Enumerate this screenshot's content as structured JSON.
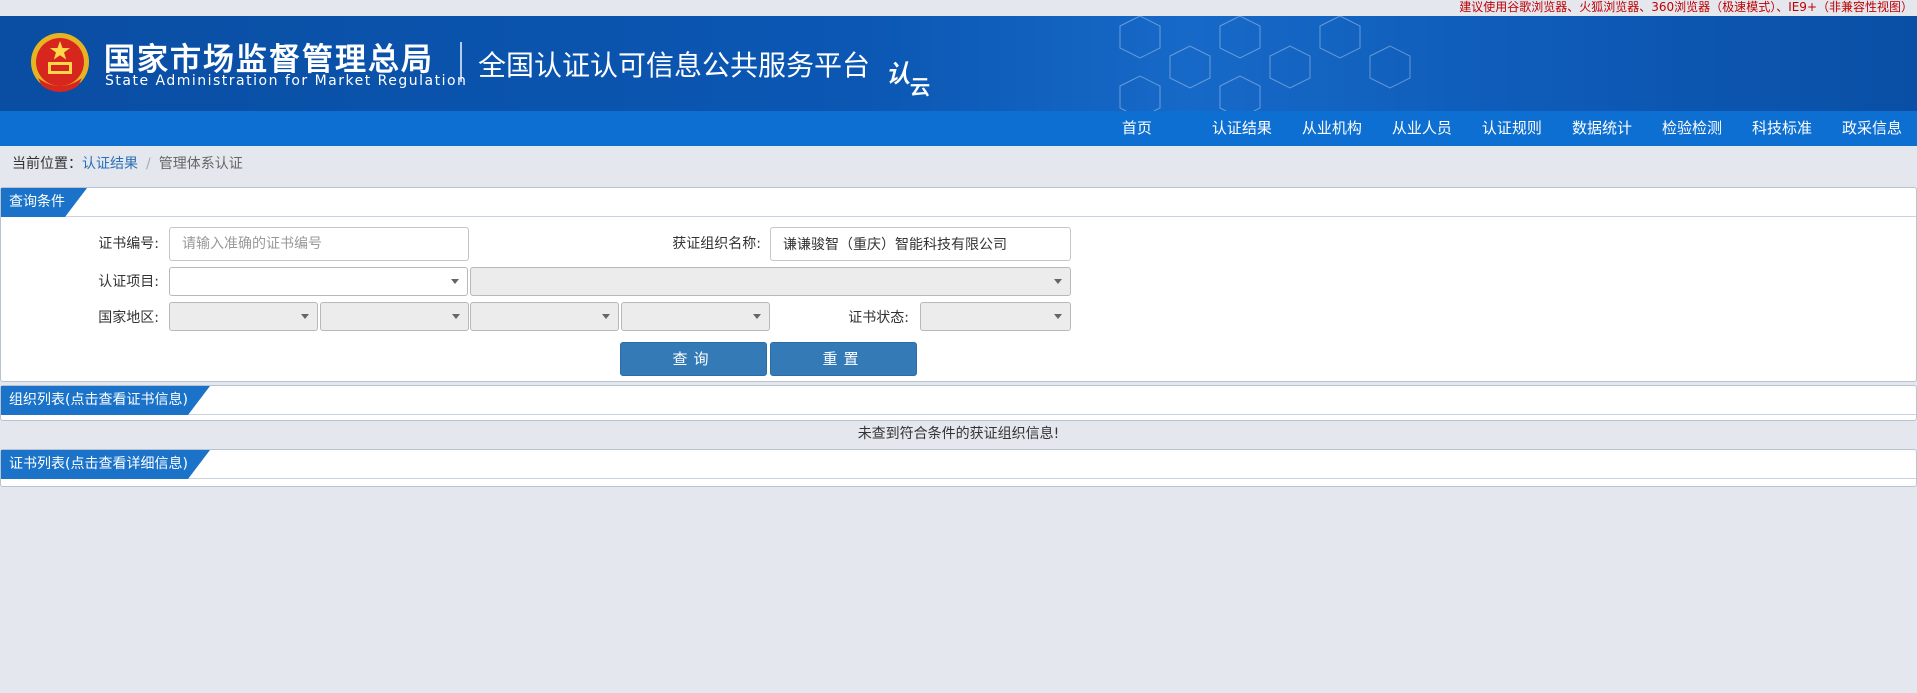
{
  "browser_tip": "建议使用谷歌浏览器、火狐浏览器、360浏览器（极速模式）、IE9+（非兼容性视图）",
  "header": {
    "org_name_cn": "国家市场监督管理总局",
    "org_name_en": "State Administration  for  Market Regulation",
    "platform_title": "全国认证认可信息公共服务平台",
    "cloud_logo_main": "认",
    "cloud_logo_sub": "云",
    "colors": {
      "header_bg": "#0b57b3",
      "nav_bg": "#0c6fd1"
    }
  },
  "nav": {
    "items": [
      "首页",
      "认证结果",
      "从业机构",
      "从业人员",
      "认证规则",
      "数据统计",
      "检验检测",
      "科技标准",
      "政采信息"
    ]
  },
  "breadcrumb": {
    "prefix": "当前位置：",
    "link": "认证结果",
    "separator": "/",
    "current": "管理体系认证"
  },
  "query": {
    "section_title": "查询条件",
    "cert_no_label": "证书编号:",
    "cert_no_placeholder": "请输入准确的证书编号",
    "cert_no_value": "",
    "org_name_label": "获证组织名称:",
    "org_name_value": "谦谦骏智（重庆）智能科技有限公司",
    "project_label": "认证项目:",
    "region_label": "国家地区:",
    "status_label": "证书状态:",
    "search_button": "查询",
    "reset_button": "重置"
  },
  "org_list": {
    "section_title": "组织列表(点击查看证书信息)",
    "empty_message": "未查到符合条件的获证组织信息!"
  },
  "cert_list": {
    "section_title": "证书列表(点击查看详细信息)"
  },
  "colors": {
    "accent": "#1a73c8",
    "button": "#337ab7",
    "page_bg": "#e4e8ee",
    "tip_red": "#c00000"
  }
}
